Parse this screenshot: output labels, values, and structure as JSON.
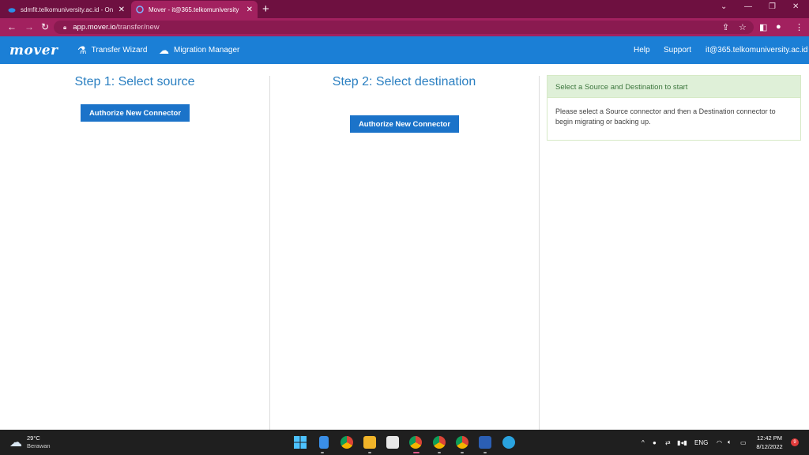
{
  "browser": {
    "tabs": [
      {
        "title": "sdmfit.telkomuniversity.ac.id - On",
        "favicon": "onedrive-cloud-icon"
      },
      {
        "title": "Mover - it@365.telkomuniversity",
        "favicon": "mover-icon"
      }
    ],
    "url_host": "app.mover.io",
    "url_path": "/transfer/new"
  },
  "app": {
    "logo": "mover",
    "nav": [
      {
        "label": "Transfer Wizard",
        "icon": "flask-icon"
      },
      {
        "label": "Migration Manager",
        "icon": "cloud-upload-icon"
      }
    ],
    "help": "Help",
    "support": "Support",
    "account": "it@365.telkomuniversity.ac.id"
  },
  "steps": {
    "source_title": "Step 1: Select source",
    "source_button": "Authorize New Connector",
    "dest_title": "Step 2: Select destination",
    "dest_button": "Authorize New Connector"
  },
  "panel": {
    "heading": "Select a Source and Destination to start",
    "body": "Please select a Source connector and then a Destination connector to begin migrating or backing up."
  },
  "taskbar": {
    "temp": "29°C",
    "condition": "Berawan",
    "language": "ENG",
    "time": "12:42 PM",
    "date": "8/12/2022",
    "notifications": "9"
  }
}
